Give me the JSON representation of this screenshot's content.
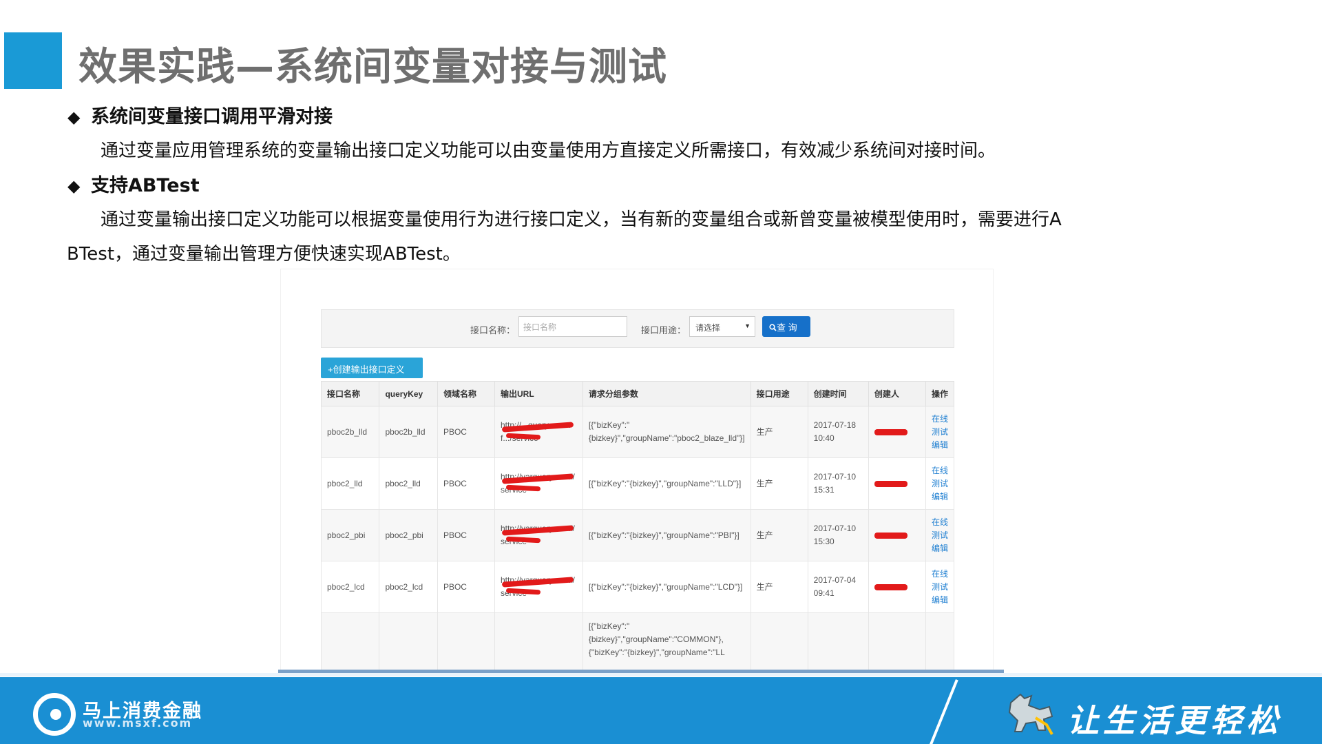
{
  "slide": {
    "title": "效果实践—系统间变量对接与测试",
    "bullet1": "系统间变量接口调用平滑对接",
    "para1": "通过变量应用管理系统的变量输出接口定义功能可以由变量使用方直接定义所需接口，有效减少系统间对接时间。",
    "bullet2": "支持ABTest",
    "para2_line1": "通过变量输出接口定义功能可以根据变量使用行为进行接口定义，当有新的变量组合或新曾变量被模型使用时，需要进行A",
    "para2_line2": "BTest，通过变量输出管理方便快速实现ABTest。",
    "bullet_glyph": "◆"
  },
  "search": {
    "name_label": "接口名称：",
    "name_placeholder": "接口名称",
    "usage_label": "接口用途：",
    "usage_value": "请选择",
    "query_button": "查 询",
    "query_icon": "search-icon"
  },
  "create_button": "+创建输出接口定义",
  "table": {
    "headers": [
      "接口名称",
      "queryKey",
      "领域名称",
      "输出URL",
      "请求分组参数",
      "接口用途",
      "创建时间",
      "创建人",
      "操作"
    ],
    "rows": [
      {
        "name": "pboc2b_lld",
        "queryKey": "pboc2b_lld",
        "domain": "PBOC",
        "url": "http://...query...msxf.../service",
        "params": "[{\"bizKey\":\"{bizkey}\",\"groupName\":\"pboc2_blaze_lld\"}]",
        "usage": "生产",
        "date": "2017-07-18",
        "time": "10:40",
        "op1": "在线测试",
        "op2": "编辑"
      },
      {
        "name": "pboc2_lld",
        "queryKey": "pboc2_lld",
        "domain": "PBOC",
        "url": "http://varquery.msxf/service",
        "params": "[{\"bizKey\":\"{bizkey}\",\"groupName\":\"LLD\"}]",
        "usage": "生产",
        "date": "2017-07-10",
        "time": "15:31",
        "op1": "在线测试",
        "op2": "编辑"
      },
      {
        "name": "pboc2_pbi",
        "queryKey": "pboc2_pbi",
        "domain": "PBOC",
        "url": "http://varquery.msxf/service",
        "params": "[{\"bizKey\":\"{bizkey}\",\"groupName\":\"PBI\"}]",
        "usage": "生产",
        "date": "2017-07-10",
        "time": "15:30",
        "op1": "在线测试",
        "op2": "编辑"
      },
      {
        "name": "pboc2_lcd",
        "queryKey": "pboc2_lcd",
        "domain": "PBOC",
        "url": "http://varquery.msxf/service",
        "params": "[{\"bizKey\":\"{bizkey}\",\"groupName\":\"LCD\"}]",
        "usage": "生产",
        "date": "2017-07-04",
        "time": "09:41",
        "op1": "在线测试",
        "op2": "编辑"
      },
      {
        "name": "",
        "queryKey": "",
        "domain": "",
        "url": "",
        "params": "[{\"bizKey\":\"{bizkey}\",\"groupName\":\"COMMON\"},{\"bizKey\":\"{bizkey}\",\"groupName\":\"LL",
        "usage": "",
        "date": "",
        "time": "",
        "op1": "",
        "op2": ""
      }
    ]
  },
  "footer": {
    "brand": "马上消费金融",
    "url": "www.msxf.com",
    "slogan": "让生活更轻松"
  },
  "colors": {
    "accent": "#1a9ad6",
    "footer": "#1a8fd3",
    "button_primary": "#1670c9",
    "button_create": "#2aa4d8",
    "link": "#1f7fd1",
    "redaction": "#e21a1a"
  }
}
